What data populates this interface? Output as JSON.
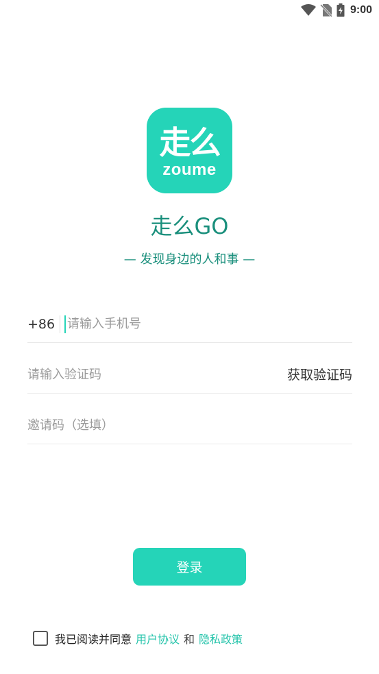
{
  "status_bar": {
    "time": "9:00",
    "icons": [
      "wifi-icon",
      "no-sim-icon",
      "battery-charging-icon"
    ]
  },
  "logo": {
    "cn": "走么",
    "en": "zoume",
    "color": "#25D4B8"
  },
  "app": {
    "name": "走么GO",
    "slogan": "— 发现身边的人和事 —"
  },
  "form": {
    "country_code": "+86",
    "phone_placeholder": "请输入手机号",
    "code_placeholder": "请输入验证码",
    "get_code_label": "获取验证码",
    "invite_placeholder": "邀请码（选填）"
  },
  "login": {
    "label": "登录"
  },
  "agreement": {
    "text": "我已阅读并同意",
    "user_agreement": "用户协议",
    "and": "和",
    "privacy_policy": "隐私政策"
  },
  "colors": {
    "accent": "#25D4B8",
    "title_text": "#1a8f7c"
  }
}
